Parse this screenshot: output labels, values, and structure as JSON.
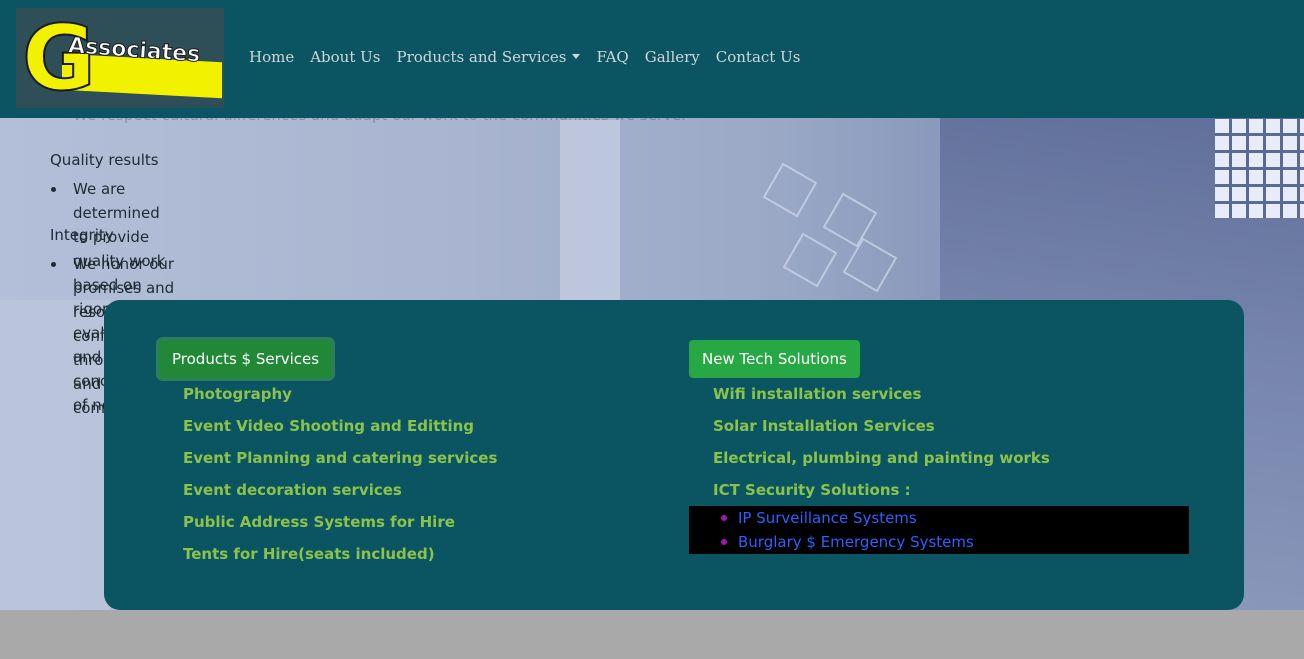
{
  "logo": {
    "letter": "G",
    "word": "Associates"
  },
  "nav": {
    "home": "Home",
    "about": "About Us",
    "products": "Products and Services",
    "faq": "FAQ",
    "gallery": "Gallery",
    "contact": "Contact Us"
  },
  "values": {
    "faded_text": "We respect cultural differences and adapt our work to the communities we serve.",
    "items": [
      {
        "heading": "Quality results",
        "text": "We are determined to provide quality work based on rigorous evaluation and concideration of new ideas."
      },
      {
        "heading": "Integrity",
        "text": "We honor our promises and resolve conflicts through direct and courteous communication"
      }
    ]
  },
  "card": {
    "left_button": "Products $ Services",
    "left_items": [
      "Photography",
      "Event Video Shooting and Editting",
      "Event Planning and catering services",
      "Event decoration services",
      "Public Address Systems for Hire",
      "Tents for Hire(seats included)"
    ],
    "right_button": "New Tech Solutions",
    "right_items": [
      "Wifi installation services",
      "Solar Installation Services",
      "Electrical, plumbing and painting works",
      "ICT Security Solutions :"
    ],
    "security_items": [
      "IP Surveillance Systems",
      "Burglary $ Emergency Systems"
    ]
  },
  "colors": {
    "navbar": "#0b5563",
    "card": "#0b5563",
    "button": "#28a745",
    "link_green": "#8bc34a",
    "sub_link": "#2962ff",
    "logo_yellow": "#f2f200"
  }
}
